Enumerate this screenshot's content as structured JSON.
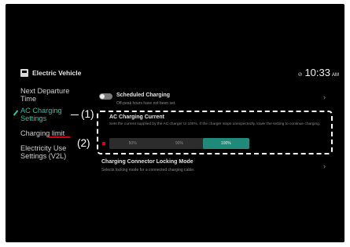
{
  "header": {
    "title": "Electric Vehicle",
    "time": "10:33",
    "ampm": "AM"
  },
  "sidebar": {
    "items": [
      {
        "line1": "Next Departure",
        "line2": "Time"
      },
      {
        "line1": "AC Charging",
        "line2": "Settings"
      },
      {
        "line1": "Charging limit",
        "line2": ""
      },
      {
        "line1": "Electricity Use",
        "line2": "Settings (V2L)"
      }
    ],
    "active_index": 1
  },
  "scheduled_charging": {
    "title": "Scheduled Charging",
    "description": "Off-peak hours have not been set.",
    "toggle_on": false
  },
  "ac_charging_current": {
    "title": "AC Charging Current",
    "description": "Sets the current supplied by the AC charger to 100%. If the charger stops unexpectedly, lower the setting to continue charging.",
    "options": [
      "50%",
      "90%",
      "100%"
    ],
    "selected": "100%"
  },
  "locking_mode": {
    "title": "Charging Connector Locking Mode",
    "description": "Selects locking mode for a connected charging cable."
  },
  "callouts": {
    "one": "(1)",
    "two": "(2)"
  },
  "colors": {
    "accent": "#2ec1a6",
    "selected_segment": "#1f8a79",
    "highlight_red": "#d10014"
  }
}
